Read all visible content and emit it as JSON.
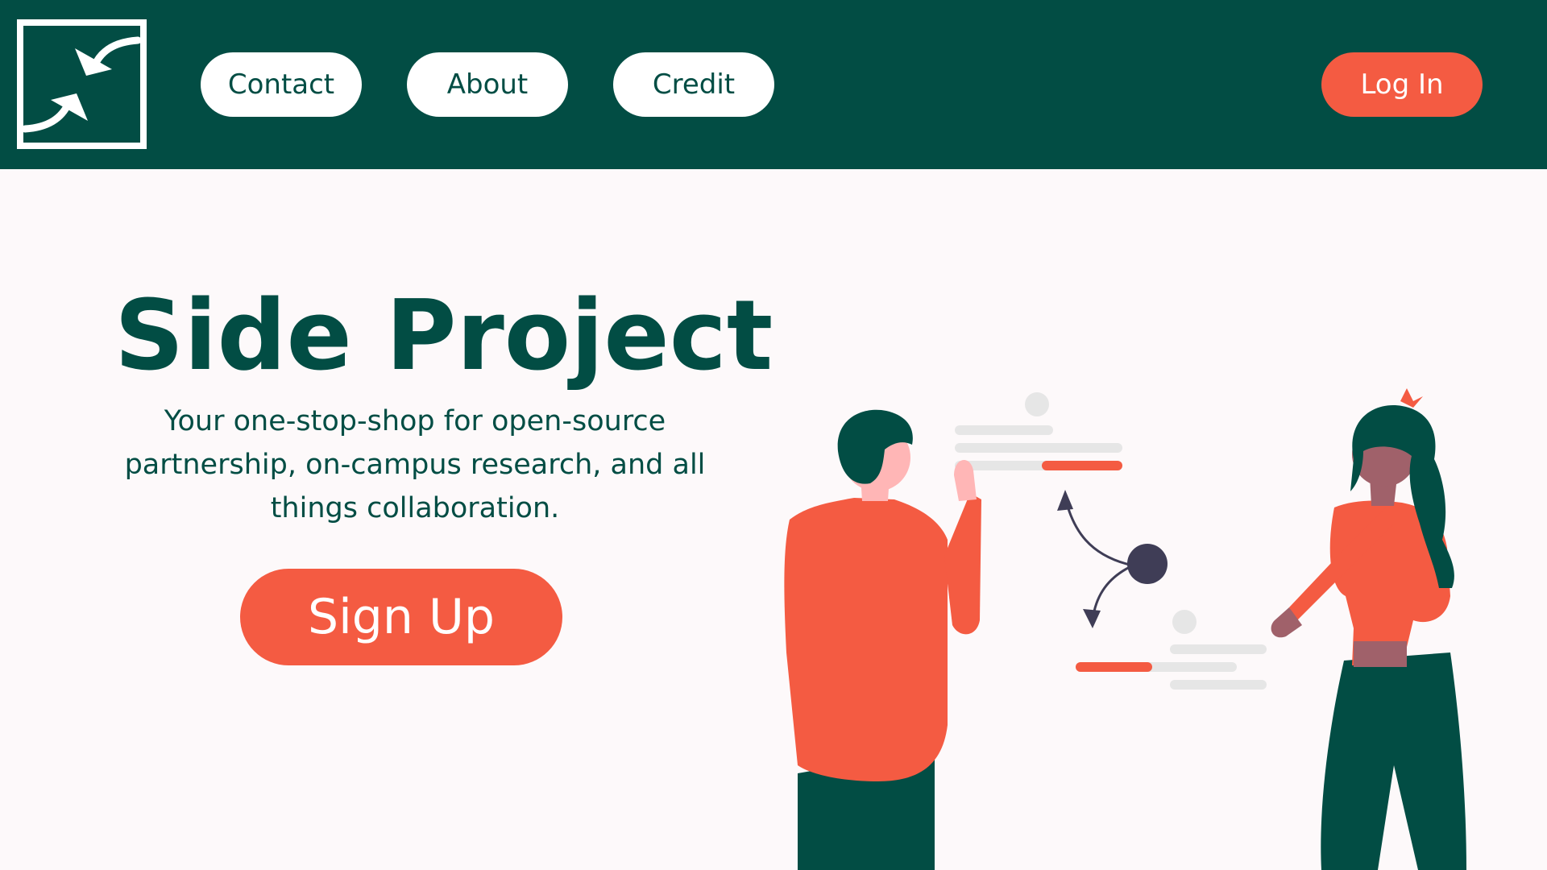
{
  "nav": {
    "logo": {
      "icon": "swap-arrows-icon"
    },
    "links": {
      "contact": "Contact",
      "about": "About",
      "credit": "Credit"
    },
    "login": "Log In"
  },
  "hero": {
    "title": "Side Project",
    "subtitle": "Your one-stop-shop for open-source partnership, on-campus research, and all things collaboration.",
    "cta": "Sign Up"
  },
  "illustration": {
    "icon": "collaboration-illustration"
  },
  "colors": {
    "primary": "#024d44",
    "accent": "#f45b42",
    "background": "#fdf9fa",
    "white": "#ffffff",
    "gray": "#e6e6e6",
    "dark": "#3f3d56",
    "skin-light": "#ffb6b6",
    "skin-dark": "#a0616a"
  }
}
